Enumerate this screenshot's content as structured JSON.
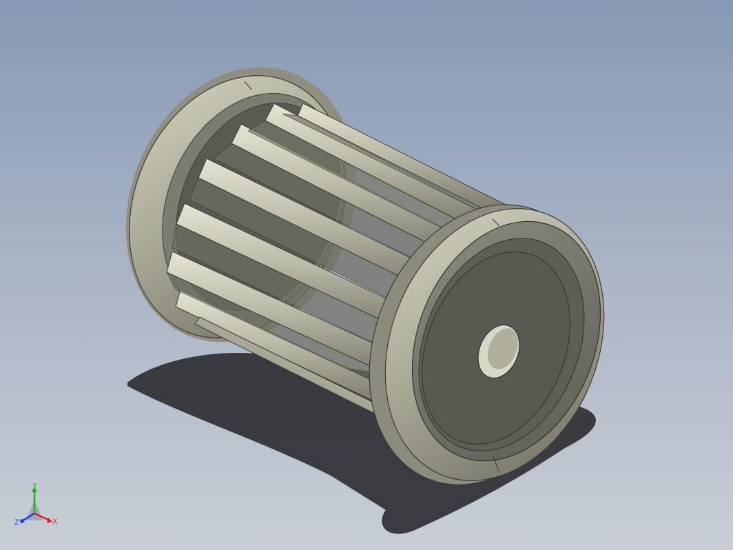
{
  "viewport": {
    "background_top": "#8799b4",
    "background_bottom": "#c9ced6"
  },
  "model": {
    "part_color": "#bdbcaa",
    "shadow_color": "#2b2b2e"
  },
  "triad": {
    "x_label": "X",
    "y_label": "Y",
    "z_label": "Z",
    "x_color": "#e02020",
    "y_color": "#20b020",
    "z_color": "#2040e0"
  }
}
